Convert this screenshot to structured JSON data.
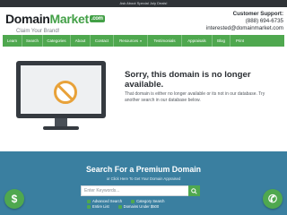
{
  "topbar": {
    "text": "Ask About Special July Deals!"
  },
  "header": {
    "logo_part1": "Domain",
    "logo_part2": "Market",
    "logo_suffix": ".com",
    "tagline": "Claim Your Brand!",
    "support_label": "Customer Support:",
    "support_phone": "(888) 694-6735",
    "support_email": "interested@domainmarket.com"
  },
  "nav": {
    "items": [
      {
        "label": "Learn"
      },
      {
        "label": "Search"
      },
      {
        "label": "Categories"
      },
      {
        "label": "About"
      },
      {
        "label": "Contact"
      },
      {
        "label": "Resources"
      },
      {
        "label": "Testimonials"
      },
      {
        "label": "Appraisals"
      },
      {
        "label": "Blog"
      },
      {
        "label": "Print"
      }
    ],
    "resources_caret": "▾"
  },
  "message": {
    "title": "Sorry, this domain is no longer available.",
    "body": "That domain is either no longer available or its not in our database. Try another search in our database below."
  },
  "search": {
    "title": "Search For a Premium Domain",
    "subtitle": "or Click Here To Get Your Domain Appraised",
    "placeholder": "Enter Keywords...",
    "links": [
      {
        "label": "Advanced Search"
      },
      {
        "label": "Category Search"
      },
      {
        "label": "Entire List"
      },
      {
        "label": "Domains Under $500"
      }
    ]
  },
  "fabs": {
    "dollar": "$",
    "phone": "✆"
  },
  "colors": {
    "brand_green": "#4fa84f",
    "search_bg": "#3a7fa0",
    "warning_orange": "#e8a23a"
  }
}
